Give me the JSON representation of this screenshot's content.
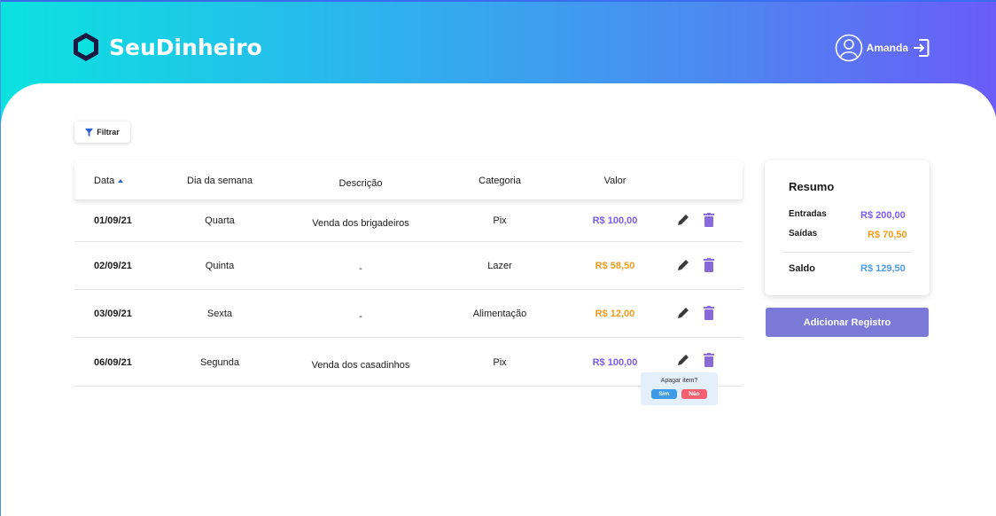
{
  "app": {
    "title": "SeuDinheiro"
  },
  "user": {
    "name": "Amanda"
  },
  "toolbar": {
    "filter_label": "Filtrar"
  },
  "table": {
    "columns": [
      "Data",
      "Dia da semana",
      "Descrição",
      "Categoria",
      "Valor"
    ],
    "rows": [
      {
        "date": "01/09/21",
        "weekday": "Quarta",
        "description": "Venda dos brigadeiros",
        "category": "Pix",
        "value": "R$ 100,00",
        "type": "income"
      },
      {
        "date": "02/09/21",
        "weekday": "Quinta",
        "description": "-",
        "category": "Lazer",
        "value": "R$ 58,50",
        "type": "expense"
      },
      {
        "date": "03/09/21",
        "weekday": "Sexta",
        "description": "-",
        "category": "Alimentação",
        "value": "R$ 12,00",
        "type": "expense"
      },
      {
        "date": "06/09/21",
        "weekday": "Segunda",
        "description": "Venda dos casadinhos",
        "category": "Pix",
        "value": "R$ 100,00",
        "type": "income"
      }
    ]
  },
  "confirm": {
    "question": "Apagar item?",
    "yes": "Sim",
    "no": "Não"
  },
  "summary": {
    "title": "Resumo",
    "entradas_label": "Entradas",
    "entradas_value": "R$ 200,00",
    "saidas_label": "Saídas",
    "saidas_value": "R$ 70,50",
    "saldo_label": "Saldo",
    "saldo_value": "R$ 129,50"
  },
  "add_button": "Adicionar Registro",
  "colors": {
    "income": "#7b5cf2",
    "expense": "#f09a1c",
    "balance": "#4a9de8",
    "trash": "#8a6ad8",
    "confirm_yes": "#3d9be9",
    "confirm_no": "#f45f72"
  },
  "icons": [
    "logo-hexagon-icon",
    "user-avatar-icon",
    "logout-icon",
    "filter-icon",
    "sort-up-icon",
    "pencil-icon",
    "trash-icon"
  ]
}
